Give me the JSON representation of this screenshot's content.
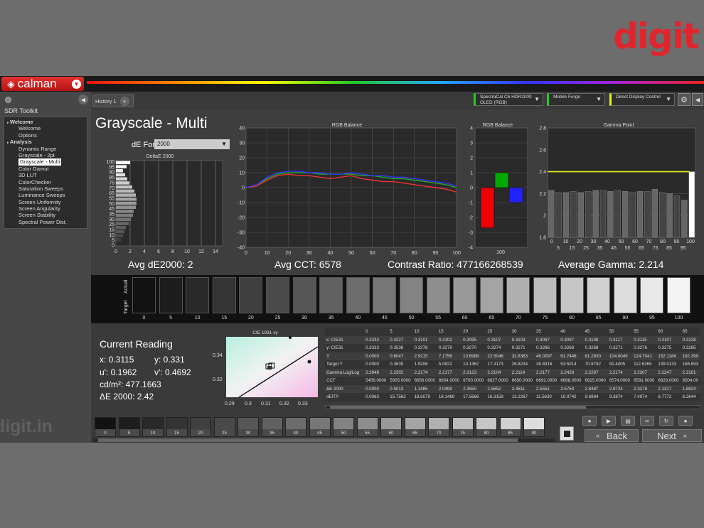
{
  "logo": "digit",
  "app": {
    "name": "calman"
  },
  "sidebar": {
    "title": "SDR Toolkit",
    "items": [
      {
        "label": "Welcome",
        "level": 0,
        "bold": true
      },
      {
        "label": "Welcome",
        "level": 1
      },
      {
        "label": "Options",
        "level": 1
      },
      {
        "label": "Analysis",
        "level": 0,
        "bold": true
      },
      {
        "label": "Dynamic Range",
        "level": 1
      },
      {
        "label": "Grayscale - 2pt",
        "level": 1
      },
      {
        "label": "Grayscale - Multi",
        "level": 1,
        "selected": true
      },
      {
        "label": "Color Gamut",
        "level": 1
      },
      {
        "label": "3D LUT",
        "level": 1
      },
      {
        "label": "ColorChecker",
        "level": 1
      },
      {
        "label": "Saturation Sweeps",
        "level": 1
      },
      {
        "label": "Luminance Sweeps",
        "level": 1
      },
      {
        "label": "Screen Uniformity",
        "level": 1
      },
      {
        "label": "Screen Angularity",
        "level": 1
      },
      {
        "label": "Screen Stability",
        "level": 1
      },
      {
        "label": "Spectral Power Dist.",
        "level": 1
      }
    ]
  },
  "tabs": {
    "history": "History 1"
  },
  "devices": {
    "meter": "SpectraCal C6 HDR2000 OLED (RGB)",
    "source": "Mobile Forge",
    "display": "Direct Display Control"
  },
  "page": {
    "title": "Grayscale - Multi",
    "formula_label": "dE Formula:",
    "formula_value": "2000",
    "avg_de": "Avg dE2000: 2",
    "avg_cct": "Avg CCT: 6578",
    "contrast": "Contrast Ratio: 477166268539",
    "avg_gamma": "Average Gamma: 2.214"
  },
  "charts": {
    "delta_e": {
      "title": "DeltaE 2000",
      "ylabels": [
        "100",
        "95",
        "90",
        "85",
        "75",
        "70",
        "65",
        "55",
        "50",
        "45",
        "35",
        "30",
        "25",
        "15",
        "10",
        "5",
        "0"
      ],
      "xticks": [
        "0",
        "2",
        "4",
        "6",
        "8",
        "10",
        "12",
        "14"
      ]
    },
    "rgb_balance": {
      "title": "RGB Balance",
      "yticks": [
        "40",
        "30",
        "20",
        "10",
        "0",
        "-10",
        "-20",
        "-30",
        "-40"
      ],
      "xticks": [
        "0",
        "10",
        "20",
        "30",
        "40",
        "50",
        "60",
        "70",
        "80",
        "90",
        "100"
      ]
    },
    "rgb_balance_bar": {
      "title": "RGB Balance",
      "yticks": [
        "4",
        "3",
        "2",
        "1",
        "0",
        "-1",
        "-2",
        "-3",
        "-4"
      ],
      "xlabel": "100"
    },
    "gamma_point": {
      "title": "Gamma Point",
      "yticks": [
        "2.8",
        "2.6",
        "2.4",
        "2.2",
        "2",
        "1.8"
      ],
      "xticks_top": [
        "0",
        "10",
        "20",
        "30",
        "40",
        "50",
        "60",
        "70",
        "80",
        "90",
        "100"
      ],
      "xticks_bottom": [
        "5",
        "15",
        "25",
        "35",
        "45",
        "55",
        "65",
        "75",
        "85",
        "95"
      ]
    },
    "cie": {
      "title": "CIE 1931 xy",
      "yticks": [
        "0.34",
        "0.32"
      ],
      "xticks": [
        "0.29",
        "0.3",
        "0.31",
        "0.32",
        "0.33"
      ]
    }
  },
  "chart_data": [
    {
      "type": "bar",
      "title": "DeltaE 2000",
      "categories": [
        "100",
        "95",
        "90",
        "85",
        "80",
        "75",
        "70",
        "65",
        "60",
        "55",
        "50",
        "45",
        "40",
        "35",
        "30",
        "25",
        "20",
        "15",
        "10",
        "5",
        "0"
      ],
      "values": [
        2.0,
        1.5,
        1.0,
        1.3,
        1.6,
        1.9,
        2.3,
        2.6,
        2.8,
        2.9,
        2.9,
        2.8,
        2.5,
        2.4,
        2.1,
        1.8,
        1.4,
        1.2,
        1.0,
        0.7,
        0.0
      ],
      "xlim": [
        0,
        15
      ]
    },
    {
      "type": "line",
      "title": "RGB Balance",
      "x": [
        0,
        5,
        10,
        15,
        20,
        25,
        30,
        35,
        40,
        45,
        50,
        55,
        60,
        65,
        70,
        75,
        80,
        85,
        90,
        95,
        100
      ],
      "series": [
        {
          "color": "#e33",
          "values": [
            0,
            1,
            5,
            8,
            9,
            8,
            8,
            7,
            6,
            7,
            8,
            6,
            5,
            4,
            4,
            3,
            2,
            1,
            0,
            -1,
            -3
          ]
        },
        {
          "color": "#2a2",
          "values": [
            0,
            2,
            6,
            9,
            10,
            10,
            10,
            9,
            9,
            9,
            9,
            8,
            8,
            7,
            6,
            6,
            5,
            4,
            3,
            2,
            0
          ]
        },
        {
          "color": "#33f",
          "values": [
            0,
            2,
            7,
            10,
            11,
            11,
            10,
            10,
            9,
            9,
            10,
            9,
            8,
            8,
            7,
            7,
            6,
            5,
            4,
            3,
            1
          ]
        }
      ],
      "ylim": [
        -40,
        40
      ]
    },
    {
      "type": "bar",
      "title": "RGB Balance",
      "categories": [
        "R",
        "G",
        "B"
      ],
      "values": [
        -2.7,
        1.0,
        -1.0
      ],
      "ylim": [
        -4,
        4
      ]
    },
    {
      "type": "bar",
      "title": "Gamma Point",
      "categories": [
        "5",
        "10",
        "15",
        "20",
        "25",
        "30",
        "35",
        "40",
        "45",
        "50",
        "55",
        "60",
        "65",
        "70",
        "75",
        "80",
        "85",
        "90",
        "95",
        "100"
      ],
      "values": [
        2.23,
        2.21,
        2.21,
        2.22,
        2.21,
        2.22,
        2.23,
        2.23,
        2.22,
        2.23,
        2.22,
        2.21,
        2.22,
        2.22,
        2.24,
        2.21,
        2.2,
        2.18,
        2.14,
        2.4
      ],
      "target": 2.4,
      "ylim": [
        1.8,
        2.8
      ]
    }
  ],
  "swatches": [
    "0",
    "5",
    "10",
    "15",
    "20",
    "25",
    "30",
    "35",
    "40",
    "45",
    "50",
    "55",
    "60",
    "65",
    "70",
    "75",
    "80",
    "85",
    "90",
    "95",
    "100"
  ],
  "swatch_labels": {
    "actual": "Actual",
    "target": "Target"
  },
  "reading": {
    "title": "Current Reading",
    "x": "x: 0.3115",
    "y": "y: 0.331",
    "u": "u': 0.1962",
    "v": "v': 0.4692",
    "cdm": "cd/m²: 477.1663",
    "de": "ΔE 2000: 2.42"
  },
  "table": {
    "headers": [
      "",
      "0",
      "5",
      "10",
      "15",
      "20",
      "25",
      "30",
      "35",
      "40",
      "45",
      "50",
      "55",
      "60",
      "65"
    ],
    "rows": [
      [
        "x: CIE31",
        "0.3333",
        "0.3227",
        "0.3101",
        "0.3102",
        "0.3095",
        "0.3107",
        "0.3103",
        "0.3097",
        "0.3097",
        "0.3108",
        "0.3117",
        "0.3115",
        "0.3107",
        "0.3128"
      ],
      [
        "y: CIE31",
        "0.3333",
        "0.3536",
        "0.3278",
        "0.3279",
        "0.3270",
        "0.3274",
        "0.3271",
        "0.3266",
        "0.3268",
        "0.3268",
        "0.3271",
        "0.3276",
        "0.3275",
        "0.3285"
      ],
      [
        "Y",
        "0.0000",
        "0.6047",
        "2.9215",
        "7.1756",
        "13.6988",
        "22.5046",
        "32.8363",
        "46.0097",
        "61.7446",
        "81.2830",
        "104.0049",
        "124.7041",
        "152.1184",
        "182.399"
      ],
      [
        "Target Y",
        "0.0000",
        "0.3639",
        "1.9206",
        "5.0822",
        "10.1367",
        "17.3173",
        "26.8234",
        "38.8316",
        "53.5014",
        "70.9792",
        "91.4005",
        "112.6265",
        "139.0133",
        "168.693"
      ],
      [
        "Gamma Log/Log",
        "2.3948",
        "2.2302",
        "2.2174",
        "2.2177",
        "2.2123",
        "2.2104",
        "2.2114",
        "2.2177",
        "2.2428",
        "2.2297",
        "2.2174",
        "2.2307",
        "2.2247",
        "2.2101"
      ],
      [
        "CCT",
        "5456.0000",
        "5905.0000",
        "6656.0000",
        "6654.0000",
        "6700.0000",
        "6627.0000",
        "6650.0000",
        "6692.0000",
        "6688.0000",
        "6625.0000",
        "6574.0000",
        "6581.0000",
        "6628.0000",
        "6504.00"
      ],
      [
        "ΔE 2000",
        "0.0000",
        "0.5013",
        "1.1485",
        "2.0499",
        "2.3550",
        "2.5652",
        "2.4511",
        "2.5551",
        "2.5753",
        "2.8487",
        "2.9724",
        "2.3278",
        "2.1317",
        "1.8824"
      ],
      [
        "dEITP",
        "0.0063",
        "15.7562",
        "18.6079",
        "18.1469",
        "17.5666",
        "16.3158",
        "13.2267",
        "11.5630",
        "10.0742",
        "9.6984",
        "9.3874",
        "7.4974",
        "6.7772",
        "6.2644"
      ]
    ]
  },
  "bottom_swatches": [
    "0",
    "5",
    "10",
    "15",
    "20",
    "25",
    "30",
    "35",
    "40",
    "45",
    "50",
    "55",
    "60",
    "65",
    "70",
    "75",
    "80",
    "85",
    "90"
  ],
  "nav": {
    "back": "Back",
    "next": "Next"
  },
  "watermark": "digit.in"
}
